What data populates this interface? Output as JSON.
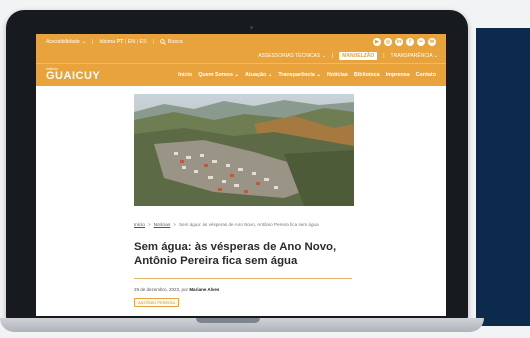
{
  "topbar": {
    "accessibility": "Acessibilidade",
    "accessibility_arrow": "⌄",
    "idioma_label": "Idioma",
    "lang_pt": "PT",
    "lang_en": "EN",
    "lang_es": "ES",
    "search": "Busca",
    "social_icons": [
      "youtube-icon",
      "instagram-icon",
      "linkedin-icon",
      "facebook-icon",
      "flickr-icon",
      "email-icon"
    ]
  },
  "subbar": {
    "assessorias": "ASSESSORIAS TÉCNICAS",
    "manuelzao": "MANUELZÃO",
    "transparencia": "TRANSPARÊNCIA"
  },
  "nav": {
    "logo_small": "Instituto",
    "logo_big": "GUAICUY",
    "items": [
      "Início",
      "Quem Somos",
      "Atuação",
      "Transparência",
      "Notícias",
      "Biblioteca",
      "Imprensa",
      "Contato"
    ]
  },
  "breadcrumb": {
    "home": "Início",
    "sep": ">",
    "news": "Notícias",
    "current": "Sem água: às vésperas de Ano Novo, Antônio Pereira fica sem água"
  },
  "article": {
    "title_line1": "Sem água: às vésperas de Ano Novo,",
    "title_line2": "Antônio Pereira fica sem água",
    "date": "29 de dezembro, 2023, por",
    "author": "Mariane Alves",
    "tag": "ANTÔNIO PEREIRA"
  },
  "colors": {
    "brand": "#e8a33d",
    "title": "#2b2b2b"
  }
}
